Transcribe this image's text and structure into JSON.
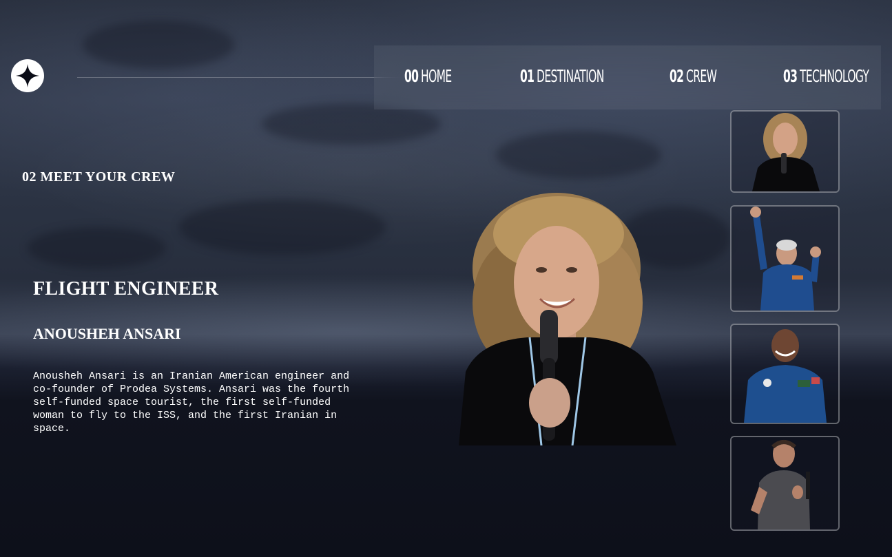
{
  "header": {
    "logo_icon": "star-icon",
    "nav": [
      {
        "num": "00",
        "label": "HOME"
      },
      {
        "num": "01",
        "label": "DESTINATION"
      },
      {
        "num": "02",
        "label": "CREW"
      },
      {
        "num": "03",
        "label": "TECHNOLOGY"
      }
    ]
  },
  "main": {
    "section_heading": "02 MEET YOUR CREW",
    "role": "FLIGHT ENGINEER",
    "name": "ANOUSHEH ANSARI",
    "bio": "Anousheh Ansari is an Iranian American engineer and co-founder of Prodea Systems. Ansari was the fourth self-funded space tourist, the first self-funded woman to fly to the ISS, and the first Iranian in space."
  },
  "crew_thumbnails": [
    {
      "icon": "crew-photo-flight-engineer-icon"
    },
    {
      "icon": "crew-photo-astronaut-cheering-icon"
    },
    {
      "icon": "crew-photo-pilot-icon"
    },
    {
      "icon": "crew-photo-speaker-icon"
    }
  ],
  "colors": {
    "background": "#0b0d17",
    "text": "#ffffff",
    "nav_panel": "rgba(255,255,255,0.06)"
  }
}
